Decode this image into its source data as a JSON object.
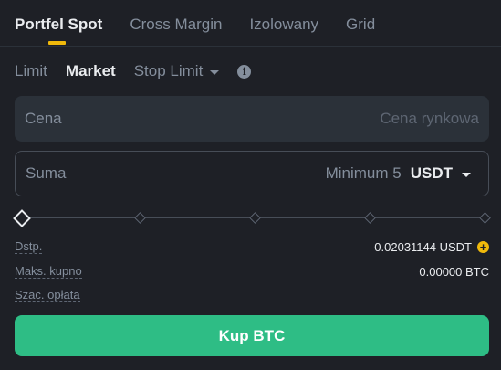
{
  "tabs": [
    {
      "label": "Portfel Spot"
    },
    {
      "label": "Cross Margin"
    },
    {
      "label": "Izolowany"
    },
    {
      "label": "Grid"
    }
  ],
  "order_types": [
    {
      "label": "Limit"
    },
    {
      "label": "Market"
    },
    {
      "label": "Stop Limit"
    }
  ],
  "info_icon_glyph": "i",
  "price": {
    "label": "Cena",
    "placeholder": "Cena rynkowa"
  },
  "amount": {
    "label": "Suma",
    "minimum": "Minimum 5",
    "unit": "USDT"
  },
  "slider": {
    "value_percent": 0,
    "marks_percent": [
      0,
      25,
      50,
      75,
      100
    ]
  },
  "info": {
    "available_label": "Dstp.",
    "available_value": "0.02031144 USDT",
    "max_buy_label": "Maks. kupno",
    "max_buy_value": "0.00000 BTC",
    "fee_label": "Szac. opłata"
  },
  "plus_glyph": "+",
  "buy_button": "Kup BTC",
  "colors": {
    "background": "#1e2026",
    "accent": "#f0b90b",
    "buy": "#2ebd85",
    "text_primary": "#eaecef",
    "text_secondary": "#848e9c"
  },
  "icons": [
    "chevron-down-icon",
    "info-icon",
    "plus-icon",
    "diamond-slider-handle"
  ]
}
